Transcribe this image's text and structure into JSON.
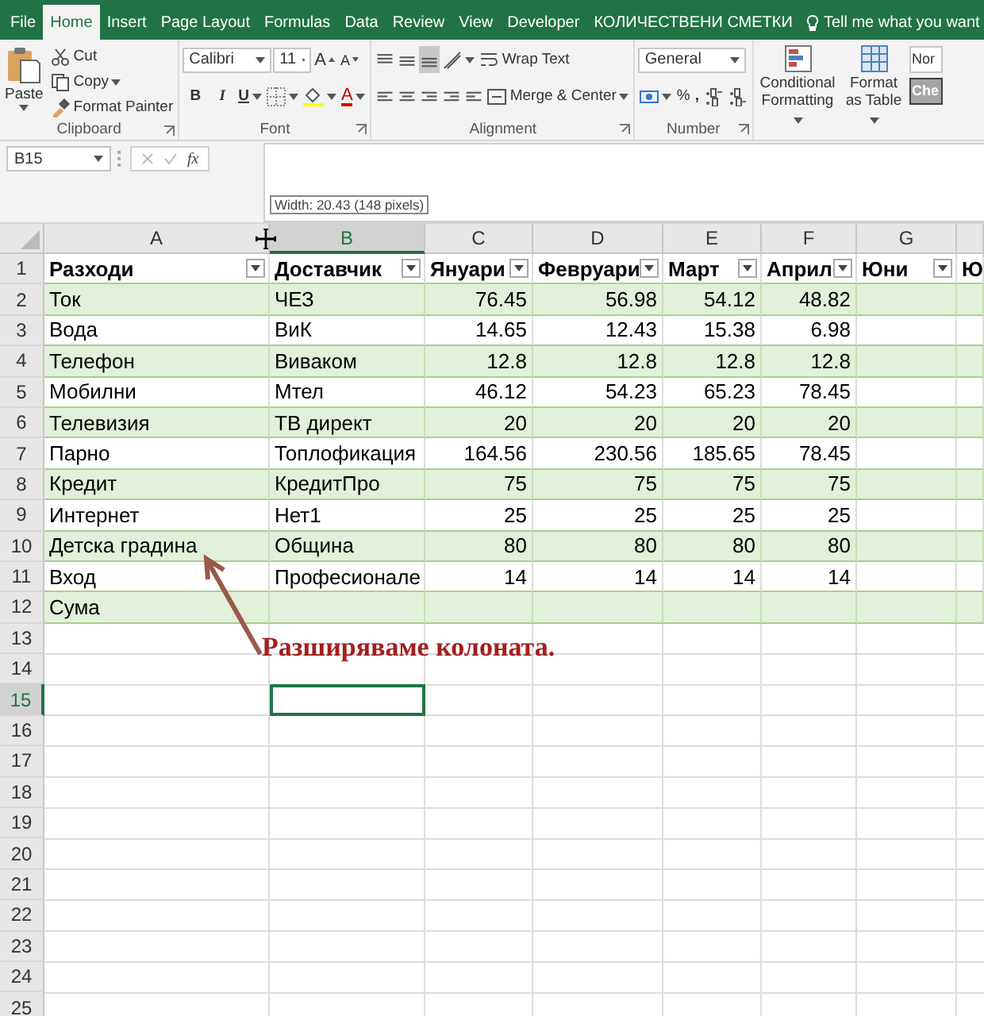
{
  "ribbon_tabs": [
    {
      "label": "File",
      "selected": false
    },
    {
      "label": "Home",
      "selected": true
    },
    {
      "label": "Insert",
      "selected": false
    },
    {
      "label": "Page Layout",
      "selected": false
    },
    {
      "label": "Formulas",
      "selected": false
    },
    {
      "label": "Data",
      "selected": false
    },
    {
      "label": "Review",
      "selected": false
    },
    {
      "label": "View",
      "selected": false
    },
    {
      "label": "Developer",
      "selected": false
    },
    {
      "label": "КОЛИЧЕСТВЕНИ СМЕТКИ",
      "selected": false
    }
  ],
  "tell_me": "Tell me what you want",
  "clipboard": {
    "paste": "Paste",
    "cut": "Cut",
    "copy": "Copy",
    "format_painter": "Format Painter",
    "label": "Clipboard"
  },
  "font": {
    "name": "Calibri",
    "size": "11",
    "grow": "A",
    "shrink": "A",
    "bold": "B",
    "italic": "I",
    "underline": "U",
    "font_color": "A",
    "label": "Font"
  },
  "alignment": {
    "wrap_text": "Wrap Text",
    "merge_center": "Merge & Center",
    "label": "Alignment"
  },
  "number": {
    "format": "General",
    "percent": "%",
    "comma": ",",
    "label": "Number"
  },
  "styles": {
    "conditional_formatting": "Conditional Formatting",
    "format_as_table": "Format as Table",
    "normal": "Nor",
    "check_cell": "Che"
  },
  "formula_bar": {
    "name_box": "B15",
    "function": "fx"
  },
  "tooltip": "Width: 20.43 (148 pixels)",
  "sheet": {
    "columns": [
      {
        "label": "A",
        "selected": false
      },
      {
        "label": "B",
        "selected": true
      },
      {
        "label": "C",
        "selected": false
      },
      {
        "label": "D",
        "selected": false
      },
      {
        "label": "E",
        "selected": false
      },
      {
        "label": "F",
        "selected": false
      },
      {
        "label": "G",
        "selected": false
      }
    ],
    "rows": [
      {
        "number": "1",
        "selected": false,
        "kind": "header",
        "cells": [
          "Разходи",
          "Доставчик",
          "Януари",
          "Февруари",
          "Март",
          "Април",
          "Юни",
          "Ю"
        ]
      },
      {
        "number": "2",
        "selected": false,
        "kind": "data",
        "cells": [
          "Ток",
          "ЧЕЗ",
          "76.45",
          "56.98",
          "54.12",
          "48.82"
        ]
      },
      {
        "number": "3",
        "selected": false,
        "kind": "data",
        "cells": [
          "Вода",
          "ВиК",
          "14.65",
          "12.43",
          "15.38",
          "6.98"
        ]
      },
      {
        "number": "4",
        "selected": false,
        "kind": "data",
        "cells": [
          "Телефон",
          "Виваком",
          "12.8",
          "12.8",
          "12.8",
          "12.8"
        ]
      },
      {
        "number": "5",
        "selected": false,
        "kind": "data",
        "cells": [
          "Мобилни",
          "Мтел",
          "46.12",
          "54.23",
          "65.23",
          "78.45"
        ]
      },
      {
        "number": "6",
        "selected": false,
        "kind": "data",
        "cells": [
          "Телевизия",
          "ТВ директ",
          "20",
          "20",
          "20",
          "20"
        ]
      },
      {
        "number": "7",
        "selected": false,
        "kind": "data",
        "cells": [
          "Парно",
          "Топлофикация",
          "164.56",
          "230.56",
          "185.65",
          "78.45"
        ]
      },
      {
        "number": "8",
        "selected": false,
        "kind": "data",
        "cells": [
          "Кредит",
          "КредитПро",
          "75",
          "75",
          "75",
          "75"
        ]
      },
      {
        "number": "9",
        "selected": false,
        "kind": "data",
        "cells": [
          "Интернет",
          "Нет1",
          "25",
          "25",
          "25",
          "25"
        ]
      },
      {
        "number": "10",
        "selected": false,
        "kind": "data",
        "cells": [
          "Детска градина",
          "Община",
          "80",
          "80",
          "80",
          "80"
        ]
      },
      {
        "number": "11",
        "selected": false,
        "kind": "data",
        "cells": [
          "Вход",
          "Професионале",
          "14",
          "14",
          "14",
          "14"
        ]
      },
      {
        "number": "12",
        "selected": false,
        "kind": "data",
        "cells": [
          "Сума"
        ]
      },
      {
        "number": "13",
        "selected": false,
        "kind": "empty"
      },
      {
        "number": "14",
        "selected": false,
        "kind": "empty"
      },
      {
        "number": "15",
        "selected": true,
        "kind": "empty"
      },
      {
        "number": "16",
        "selected": false,
        "kind": "empty"
      },
      {
        "number": "17",
        "selected": false,
        "kind": "empty"
      },
      {
        "number": "18",
        "selected": false,
        "kind": "empty"
      },
      {
        "number": "19",
        "selected": false,
        "kind": "empty"
      },
      {
        "number": "20",
        "selected": false,
        "kind": "empty"
      },
      {
        "number": "21",
        "selected": false,
        "kind": "empty"
      },
      {
        "number": "22",
        "selected": false,
        "kind": "empty"
      },
      {
        "number": "23",
        "selected": false,
        "kind": "empty"
      },
      {
        "number": "24",
        "selected": false,
        "kind": "empty"
      },
      {
        "number": "25",
        "selected": false,
        "kind": "empty"
      }
    ]
  },
  "annotation": "Разширяваме колоната."
}
